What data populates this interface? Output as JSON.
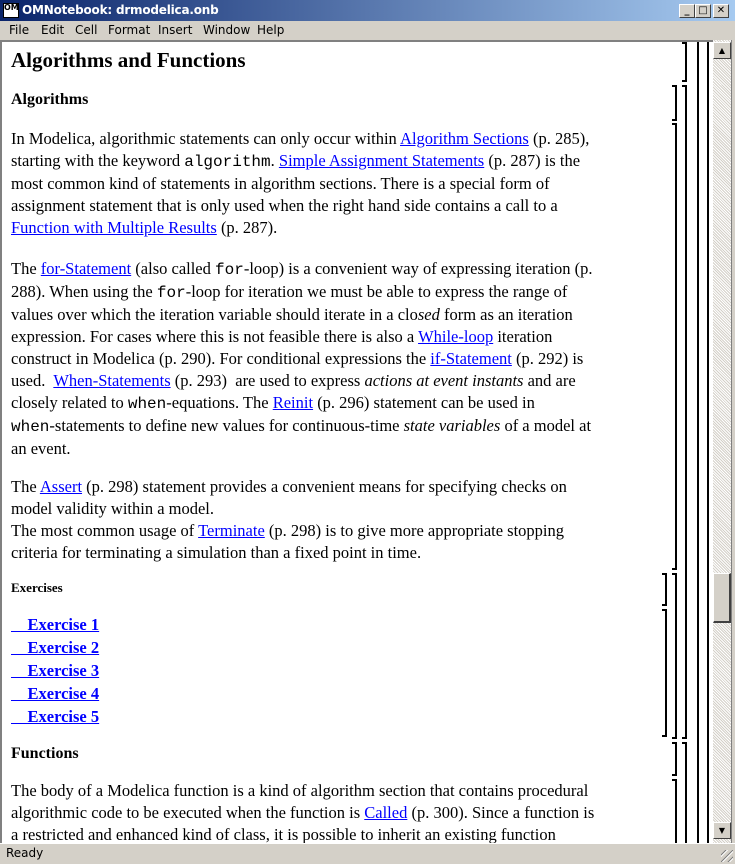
{
  "window": {
    "app_icon_label": "OM",
    "title": "OMNotebook: drmodelica.onb",
    "controls": {
      "minimize": "_",
      "maximize": "□",
      "close": "✕"
    }
  },
  "menu": [
    "File",
    "Edit",
    "Cell",
    "Format",
    "Insert",
    "Window",
    "Help"
  ],
  "document": {
    "title": "Algorithms and Functions",
    "sections": {
      "algorithms_heading": "Algorithms",
      "para1": {
        "l1_a": "In Modelica, algorithmic statements can only occur within ",
        "l1_link": "Algorithm Sections",
        "l1_b": " (p. 285),",
        "l2_a": "starting with the keyword ",
        "l2_code": "algorithm",
        "l2_b": ". ",
        "l2_link": "Simple Assignment Statements",
        "l2_c": " (p. 287) is the",
        "l3": "most common kind of statements in algorithm sections. There is a special form of",
        "l4": "assignment statement that is only used when the right hand side contains a call to a",
        "l5_link": "Function with Multiple Results",
        "l5_b": " (p. 287)."
      },
      "para2": {
        "l1_a": "The ",
        "l1_link": "for-Statement",
        "l1_b": " (also called ",
        "l1_code": "for",
        "l1_c": "-loop) is a convenient way of expressing iteration (p.",
        "l2_a": "288). When using the ",
        "l2_code": "for",
        "l2_b": "-loop for iteration we must be able to express the range of",
        "l3_a": "values over which the iteration variable should iterate in a clo",
        "l3_ital": "sed",
        "l3_b": " form as an iteration",
        "l4_a": "expression. For cases where this is not feasible there is also a ",
        "l4_link": "While-loop",
        "l4_b": " iteration",
        "l5_a": "construct in Modelica (p. 290). For conditional expressions the ",
        "l5_link": "if-Statement",
        "l5_b": " (p. 292) is",
        "l6_a": "used.  ",
        "l6_link": "When-Statements",
        "l6_b": " (p. 293)  are used to express ",
        "l6_ital": "actions at event instants",
        "l6_c": " and are",
        "l7_a": "closely related to ",
        "l7_code": "when",
        "l7_b": "-equations. The ",
        "l7_link": "Reinit",
        "l7_c": " (p. 296) statement can be used in",
        "l8_code": "when",
        "l8_a": "-statements to define new values for continuous-time ",
        "l8_ital": "state variables",
        "l8_b": " of a model at",
        "l9": "an event."
      },
      "para3": {
        "l1_a": "The ",
        "l1_link": "Assert",
        "l1_b": " (p. 298) statement provides a convenient means for specifying checks on",
        "l2": "model validity within a model.",
        "l3_a": "The most common usage of ",
        "l3_link": "Terminate",
        "l3_b": " (p. 298) is to give more appropriate stopping",
        "l4": "criteria for terminating a simulation than a fixed point in time."
      },
      "exercises_heading": "Exercises",
      "exercises": [
        "    Exercise 1",
        "    Exercise 2",
        "    Exercise 3",
        "    Exercise 4",
        "    Exercise 5"
      ],
      "functions_heading": "Functions",
      "para4": {
        "l1": "The body of a Modelica function is a kind of algorithm section that contains procedural",
        "l2_a": "algorithmic code to be executed when the function is ",
        "l2_link": "Called",
        "l2_b": " (p. 300). Since a function is",
        "l3": "a restricted and enhanced kind of class, it is possible to inherit an existing function"
      }
    }
  },
  "scrollbar": {
    "up_arrow": "▲",
    "down_arrow": "▼",
    "position_fraction": 0.66
  },
  "status": {
    "text": "Ready"
  },
  "colors": {
    "link": "#0000ff",
    "titlebar_start": "#0a246a",
    "titlebar_end": "#a6caf0",
    "chrome": "#d4d0c8"
  }
}
